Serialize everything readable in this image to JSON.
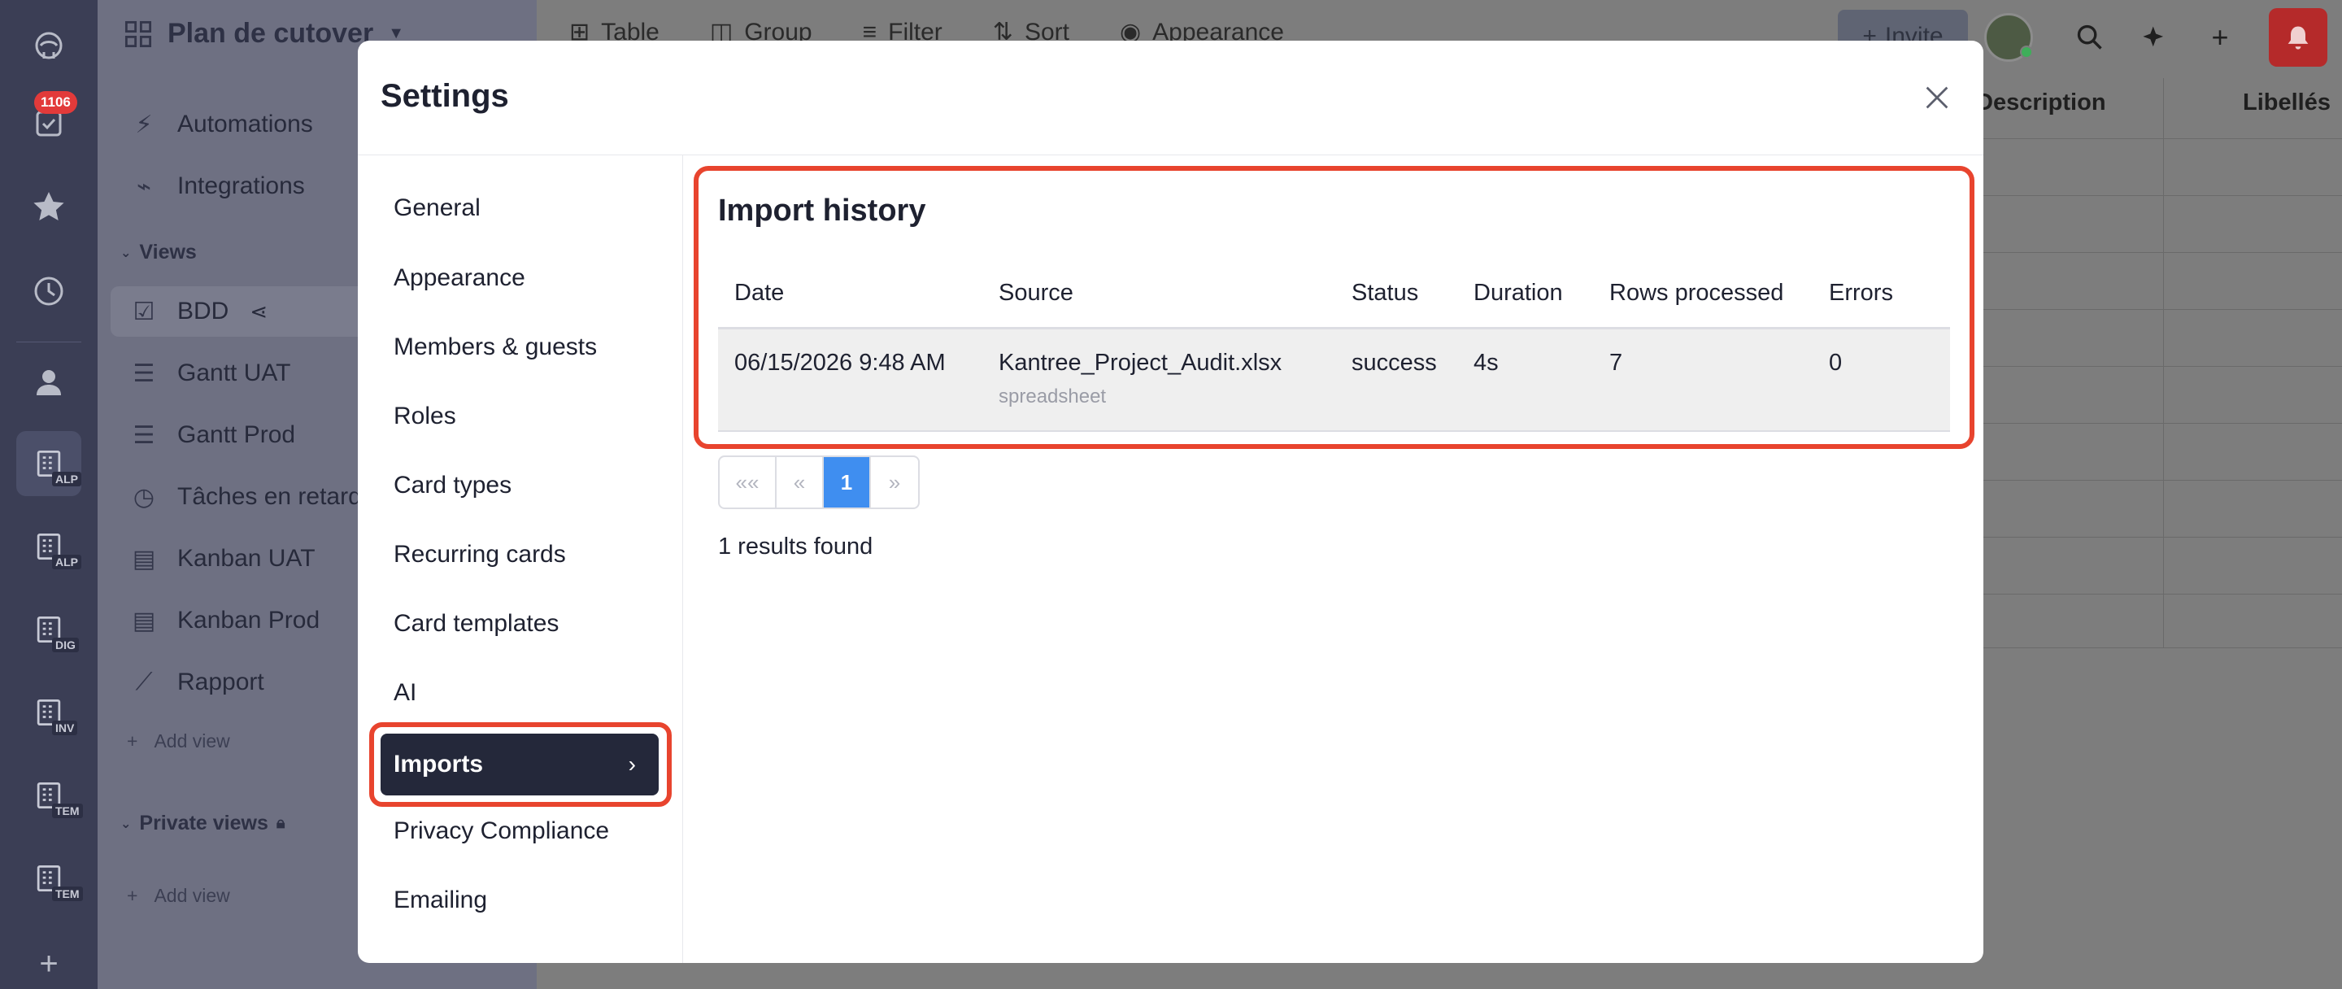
{
  "rail": {
    "notification_count": "1106",
    "boards": [
      {
        "tag": "ALP",
        "active": true
      },
      {
        "tag": "ALP",
        "active": false
      },
      {
        "tag": "DIG",
        "active": false
      },
      {
        "tag": "INV",
        "active": false
      },
      {
        "tag": "TEM",
        "active": false
      },
      {
        "tag": "TEM",
        "active": false
      }
    ],
    "add_label": "+"
  },
  "sidebar": {
    "title": "Plan de cutover",
    "automations": "Automations",
    "integrations": "Integrations",
    "views_section": "Views",
    "views": [
      {
        "label": "BDD",
        "icon": "checkbox-icon"
      },
      {
        "label": "Gantt UAT",
        "icon": "gantt-icon"
      },
      {
        "label": "Gantt Prod",
        "icon": "gantt-icon"
      },
      {
        "label": "Tâches en retard",
        "icon": "clock-icon"
      },
      {
        "label": "Kanban UAT",
        "icon": "kanban-icon"
      },
      {
        "label": "Kanban Prod",
        "icon": "kanban-icon"
      },
      {
        "label": "Rapport",
        "icon": "chart-line-icon"
      }
    ],
    "add_view": "Add view",
    "private_section": "Private views",
    "add_private_view": "Add view"
  },
  "main": {
    "toolbar": [
      "Table",
      "Group",
      "Filter",
      "Sort",
      "Appearance"
    ],
    "invite": "Invite",
    "columns": [
      "Description",
      "Libellés"
    ]
  },
  "modal": {
    "title": "Settings",
    "nav": [
      "General",
      "Appearance",
      "Members & guests",
      "Roles",
      "Card types",
      "Recurring cards",
      "Card templates",
      "AI",
      "Imports",
      "Privacy Compliance",
      "Emailing"
    ],
    "active_nav": "Imports",
    "section_title": "Import history",
    "table": {
      "headers": [
        "Date",
        "Source",
        "Status",
        "Duration",
        "Rows processed",
        "Errors"
      ],
      "rows": [
        {
          "date": "06/15/2026 9:48 AM",
          "source": "Kantree_Project_Audit.xlsx",
          "source_type": "spreadsheet",
          "status": "success",
          "duration": "4s",
          "rows_processed": "7",
          "errors": "0"
        }
      ]
    },
    "pagination": {
      "first": "««",
      "prev": "«",
      "current": "1",
      "next": "»"
    },
    "results": "1 results found"
  },
  "colors": {
    "accent_highlight": "#e8442e",
    "active_nav_bg": "#24283a",
    "pager_active": "#3f8ef0",
    "notification_badge": "#e23a3a"
  }
}
